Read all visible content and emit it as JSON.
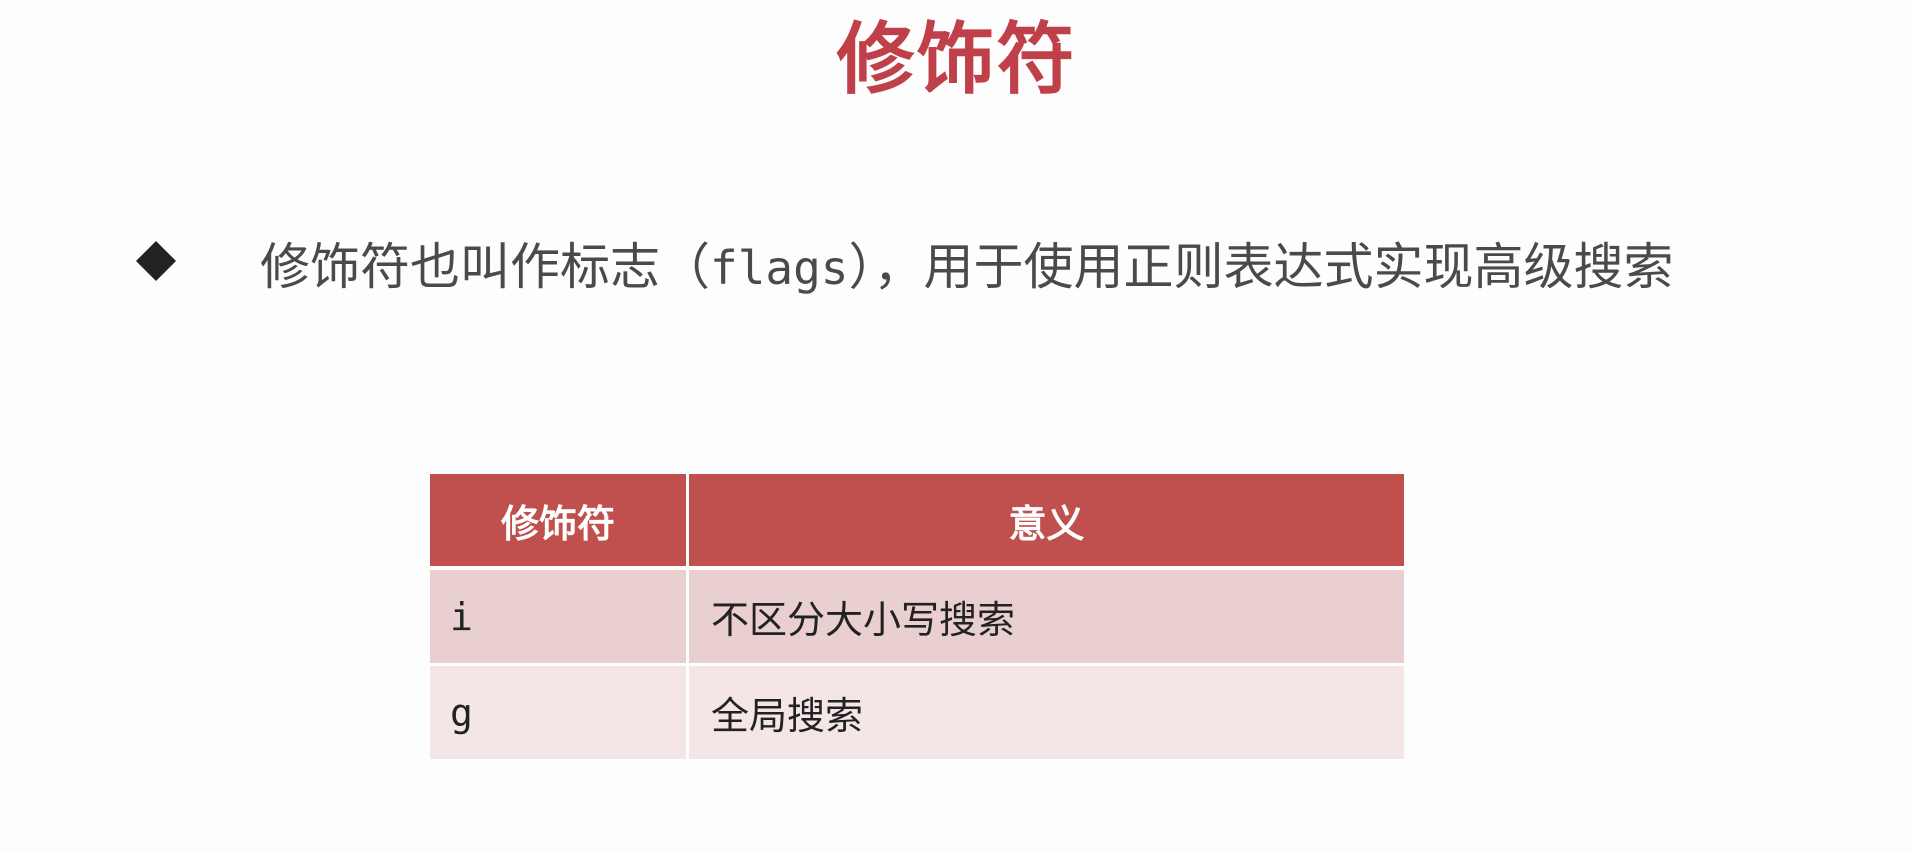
{
  "slide": {
    "title": "修饰符",
    "bullet": {
      "text_before": "修饰符也叫作标志（",
      "code": "flags",
      "text_after": "），用于使用正则表达式实现高级搜索"
    },
    "table": {
      "headers": [
        "修饰符",
        "意义"
      ],
      "rows": [
        {
          "flag": "i",
          "meaning": "不区分大小写搜索"
        },
        {
          "flag": "g",
          "meaning": "全局搜索"
        }
      ]
    }
  },
  "colors": {
    "title": "#c0404a",
    "header_bg": "#c0504d",
    "row_odd_bg": "#e9cfcf",
    "row_even_bg": "#f4e6e6",
    "bullet_text": "#4a4a4a"
  }
}
